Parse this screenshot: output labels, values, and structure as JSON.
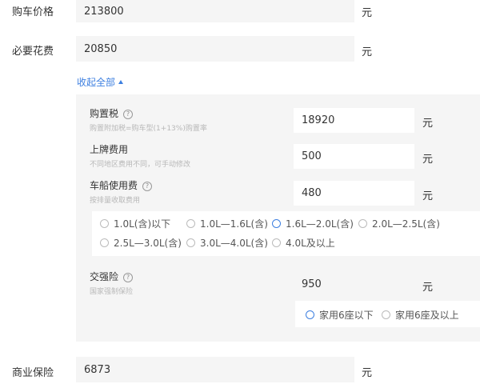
{
  "form": {
    "car_price": {
      "label": "购车价格",
      "value": "213800",
      "unit": "元"
    },
    "required_fees": {
      "label": "必要花费",
      "value": "20850",
      "unit": "元"
    },
    "collapse_link": "收起全部",
    "commercial_insurance": {
      "label": "商业保险",
      "value": "6873",
      "unit": "元"
    }
  },
  "details": {
    "purchase_tax": {
      "label": "购置税",
      "hint": "购置附加税=购车型(1+13%)购置率",
      "value": "18920",
      "unit": "元"
    },
    "plate_fee": {
      "label": "上牌费用",
      "hint": "不同地区费用不同，可手动修改",
      "value": "500",
      "unit": "元"
    },
    "vehicle_tax": {
      "label": "车船使用费",
      "hint": "按排量收取费用",
      "value": "480",
      "unit": "元",
      "options": [
        "1.0L(含)以下",
        "1.0L—1.6L(含)",
        "1.6L—2.0L(含)",
        "2.0L—2.5L(含)",
        "2.5L—3.0L(含)",
        "3.0L—4.0L(含)",
        "4.0L及以上"
      ],
      "selected": "1.6L—2.0L(含)"
    },
    "compulsory_insurance": {
      "label": "交强险",
      "hint": "国家强制保险",
      "value": "950",
      "unit": "元",
      "options": [
        "家用6座以下",
        "家用6座及以上"
      ],
      "selected": "家用6座以下"
    }
  },
  "colors": {
    "accent": "#3d7fe0",
    "panel_bg": "#f5f5f5"
  },
  "icons": {
    "help": "question-circle-icon",
    "collapse": "triangle-up-icon"
  }
}
